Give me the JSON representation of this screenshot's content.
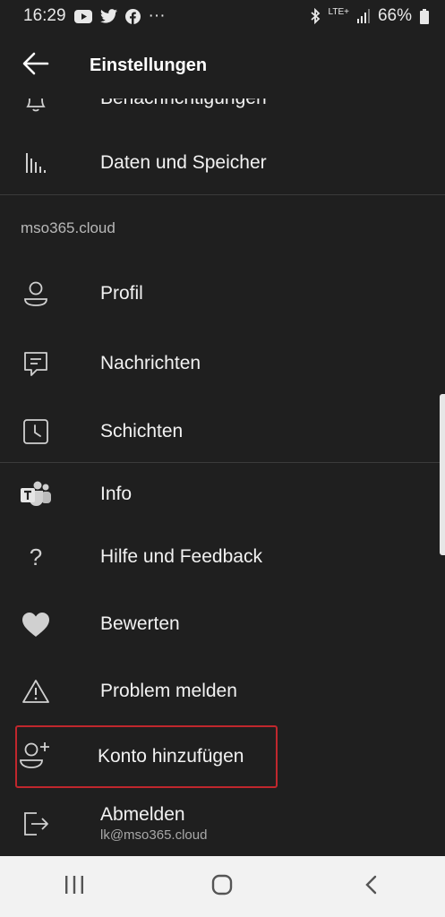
{
  "status_bar": {
    "time": "16:29",
    "more": "···",
    "network": "LTE+",
    "battery": "66%",
    "icons": [
      "youtube-icon",
      "twitter-icon",
      "facebook-icon",
      "bluetooth-icon",
      "signal-icon",
      "battery-icon"
    ]
  },
  "app_bar": {
    "title": "Einstellungen",
    "back_icon": "arrow-left-icon"
  },
  "items_top": [
    {
      "label": "Benachrichtigungen",
      "icon": "bell-icon"
    },
    {
      "label": "Daten und Speicher",
      "icon": "data-storage-icon"
    }
  ],
  "section": {
    "header": "mso365.cloud"
  },
  "account_items": [
    {
      "label": "Profil",
      "icon": "person-icon"
    },
    {
      "label": "Nachrichten",
      "icon": "message-icon"
    },
    {
      "label": "Schichten",
      "icon": "clock-icon"
    }
  ],
  "general_items": [
    {
      "label": "Info",
      "icon": "teams-icon"
    },
    {
      "label": "Hilfe und Feedback",
      "icon": "question-icon"
    },
    {
      "label": "Bewerten",
      "icon": "heart-icon"
    },
    {
      "label": "Problem melden",
      "icon": "warning-icon"
    },
    {
      "label": "Konto hinzufügen",
      "icon": "person-add-icon"
    },
    {
      "label": "Abmelden",
      "sublabel": "lk@mso365.cloud",
      "icon": "sign-out-icon"
    }
  ],
  "colors": {
    "background": "#1f1f1f",
    "highlight": "#c0272d",
    "nav_bar": "#f2f2f2"
  },
  "nav_bar": {
    "icons": [
      "recent-apps-icon",
      "home-icon",
      "back-icon"
    ]
  }
}
